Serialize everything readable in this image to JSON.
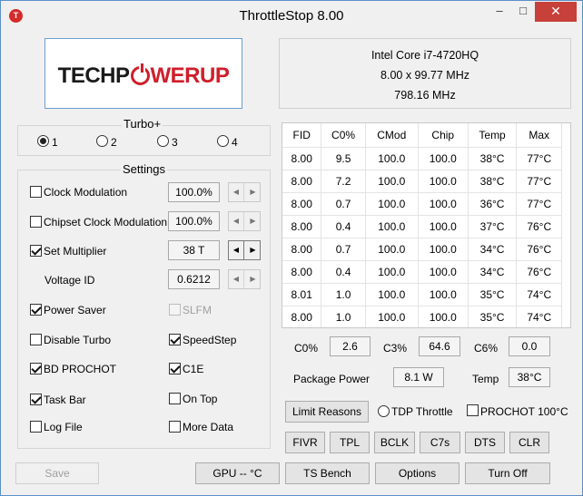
{
  "window": {
    "title": "ThrottleStop 8.00",
    "app_icon": "T",
    "controls": {
      "minimize": "–",
      "maximize": "□",
      "close": "✕"
    }
  },
  "logo": {
    "part1": "TECHP",
    "part2": "WERUP"
  },
  "cpu_info": {
    "name": "Intel Core i7-4720HQ",
    "multiplier_line": "8.00 x 99.77 MHz",
    "frequency": "798.16 MHz"
  },
  "turbo": {
    "label": "Turbo+",
    "profiles": [
      "1",
      "2",
      "3",
      "4"
    ],
    "selected": "1"
  },
  "settings": {
    "label": "Settings",
    "clock_modulation": {
      "label": "Clock Modulation",
      "value": "100.0%",
      "checked": false
    },
    "chipset_clock_modulation": {
      "label": "Chipset Clock Modulation",
      "value": "100.0%",
      "checked": false
    },
    "set_multiplier": {
      "label": "Set Multiplier",
      "value": "38 T",
      "checked": true
    },
    "voltage_id": {
      "label": "Voltage ID",
      "value": "0.6212"
    },
    "power_saver": {
      "label": "Power Saver",
      "checked": true
    },
    "slfm": {
      "label": "SLFM",
      "checked": false,
      "disabled": true
    },
    "disable_turbo": {
      "label": "Disable Turbo",
      "checked": false
    },
    "speedstep": {
      "label": "SpeedStep",
      "checked": true
    },
    "bd_prochot": {
      "label": "BD PROCHOT",
      "checked": true
    },
    "c1e": {
      "label": "C1E",
      "checked": true
    },
    "task_bar": {
      "label": "Task Bar",
      "checked": true
    },
    "on_top": {
      "label": "On Top",
      "checked": false
    },
    "log_file": {
      "label": "Log File",
      "checked": false
    },
    "more_data": {
      "label": "More Data",
      "checked": false
    }
  },
  "spin_arrows": {
    "left": "◀",
    "right": "▶"
  },
  "table": {
    "headers": [
      "FID",
      "C0%",
      "CMod",
      "Chip",
      "Temp",
      "Max"
    ],
    "rows": [
      [
        "8.00",
        "9.5",
        "100.0",
        "100.0",
        "38°C",
        "77°C"
      ],
      [
        "8.00",
        "7.2",
        "100.0",
        "100.0",
        "38°C",
        "77°C"
      ],
      [
        "8.00",
        "0.7",
        "100.0",
        "100.0",
        "36°C",
        "77°C"
      ],
      [
        "8.00",
        "0.4",
        "100.0",
        "100.0",
        "37°C",
        "76°C"
      ],
      [
        "8.00",
        "0.7",
        "100.0",
        "100.0",
        "34°C",
        "76°C"
      ],
      [
        "8.00",
        "0.4",
        "100.0",
        "100.0",
        "34°C",
        "76°C"
      ],
      [
        "8.01",
        "1.0",
        "100.0",
        "100.0",
        "35°C",
        "74°C"
      ],
      [
        "8.00",
        "1.0",
        "100.0",
        "100.0",
        "35°C",
        "74°C"
      ]
    ]
  },
  "stats": {
    "c0_label": "C0%",
    "c0_value": "2.6",
    "c3_label": "C3%",
    "c3_value": "64.6",
    "c6_label": "C6%",
    "c6_value": "0.0",
    "package_power_label": "Package Power",
    "package_power_value": "8.1 W",
    "temp_label": "Temp",
    "temp_value": "38°C"
  },
  "limit_row": {
    "limit_reasons": "Limit Reasons",
    "tdp_throttle": "TDP Throttle",
    "prochot": "PROCHOT 100°C"
  },
  "tool_buttons": [
    "FIVR",
    "TPL",
    "BCLK",
    "C7s",
    "DTS",
    "CLR"
  ],
  "bottom": {
    "save": "Save",
    "gpu": "GPU -- °C",
    "ts_bench": "TS Bench",
    "options": "Options",
    "turn_off": "Turn Off"
  },
  "colors": {
    "logo_red": "#d01e2a",
    "window_bg": "#f0f0f0",
    "close_red": "#c7403a"
  }
}
